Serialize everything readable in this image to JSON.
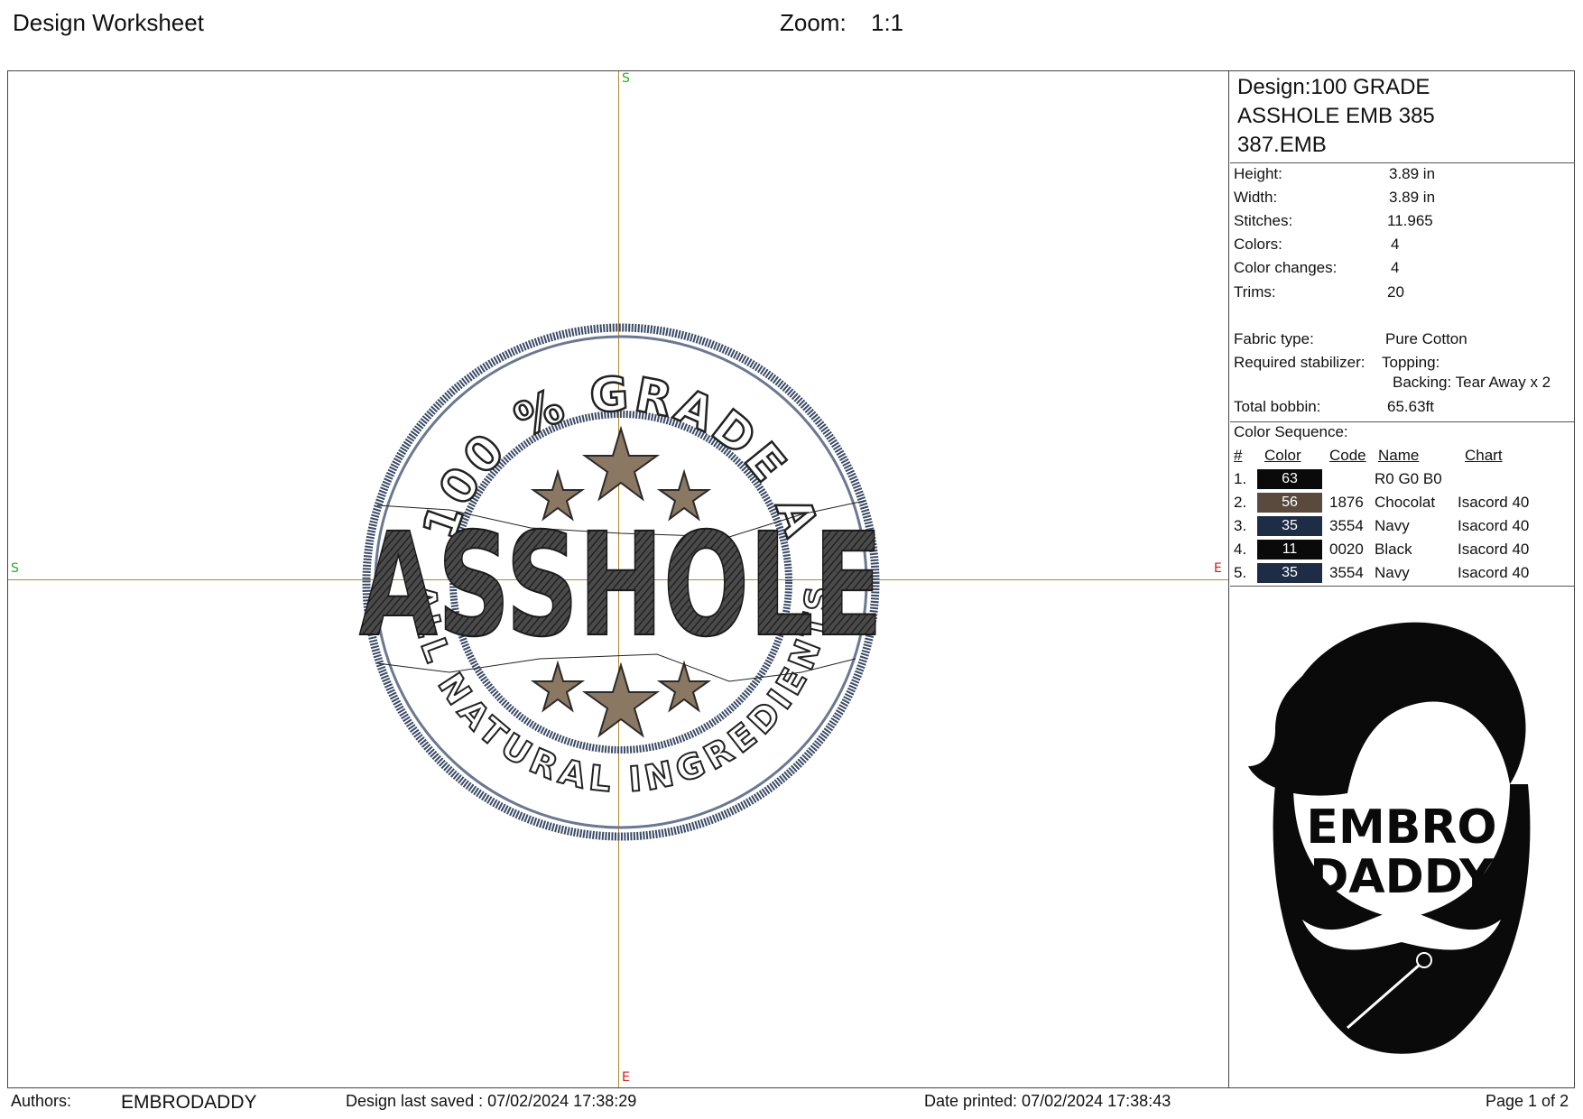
{
  "header": {
    "title": "Design Worksheet",
    "zoom_label": "Zoom:",
    "zoom_value": "1:1"
  },
  "canvas": {
    "axis_labels": {
      "top": "S",
      "left": "S",
      "right": "E",
      "bottom": "E"
    },
    "design_text": {
      "top_arc": "100 % GRADE A",
      "main": "ASSHOLE",
      "bottom_arc": "ALL NATURAL INGREDIENTS"
    }
  },
  "info": {
    "design_title_lines": [
      "Design:100 GRADE",
      "ASSHOLE EMB 385",
      "387.EMB"
    ],
    "stats": [
      {
        "label": "Height:",
        "value": "3.89 in"
      },
      {
        "label": "Width:",
        "value": "3.89 in"
      },
      {
        "label": "Stitches:",
        "value": "11.965"
      },
      {
        "label": "Colors:",
        "value": "4"
      },
      {
        "label": "Color changes:",
        "value": "4"
      },
      {
        "label": "Trims:",
        "value": "20"
      }
    ],
    "fabric_label": "Fabric type:",
    "fabric_value": "Pure Cotton",
    "stabilizer_label": "Required stabilizer:",
    "topping": "Topping:",
    "backing": "Backing: Tear Away x 2",
    "bobbin_label": "Total bobbin:",
    "bobbin_value": "65.63ft",
    "sequence_title": "Color Sequence:",
    "sequence_headers": {
      "num": "#",
      "color": "Color",
      "code": "Code",
      "name": "Name",
      "chart": "Chart"
    },
    "sequence": [
      {
        "num": "1.",
        "swatch": "63",
        "color": "#0a0a0a",
        "code": "",
        "name": "R0 G0 B0",
        "chart": ""
      },
      {
        "num": "2.",
        "swatch": "56",
        "color": "#5a4a3e",
        "code": "1876",
        "name": "Chocolat",
        "chart": "Isacord 40"
      },
      {
        "num": "3.",
        "swatch": "35",
        "color": "#1e2d45",
        "code": "3554",
        "name": "Navy",
        "chart": "Isacord 40"
      },
      {
        "num": "4.",
        "swatch": "11",
        "color": "#0a0a0a",
        "code": "0020",
        "name": "Black",
        "chart": "Isacord 40"
      },
      {
        "num": "5.",
        "swatch": "35",
        "color": "#1e2d45",
        "code": "3554",
        "name": "Navy",
        "chart": "Isacord 40"
      }
    ],
    "logo_text": [
      "EMBRO",
      "DADDY"
    ]
  },
  "footer": {
    "authors_label": "Authors:",
    "authors_value": "EMBRODADDY",
    "saved": "Design last saved : 07/02/2024 17:38:29",
    "printed": "Date printed: 07/02/2024 17:38:43",
    "page": "Page 1 of 2"
  }
}
